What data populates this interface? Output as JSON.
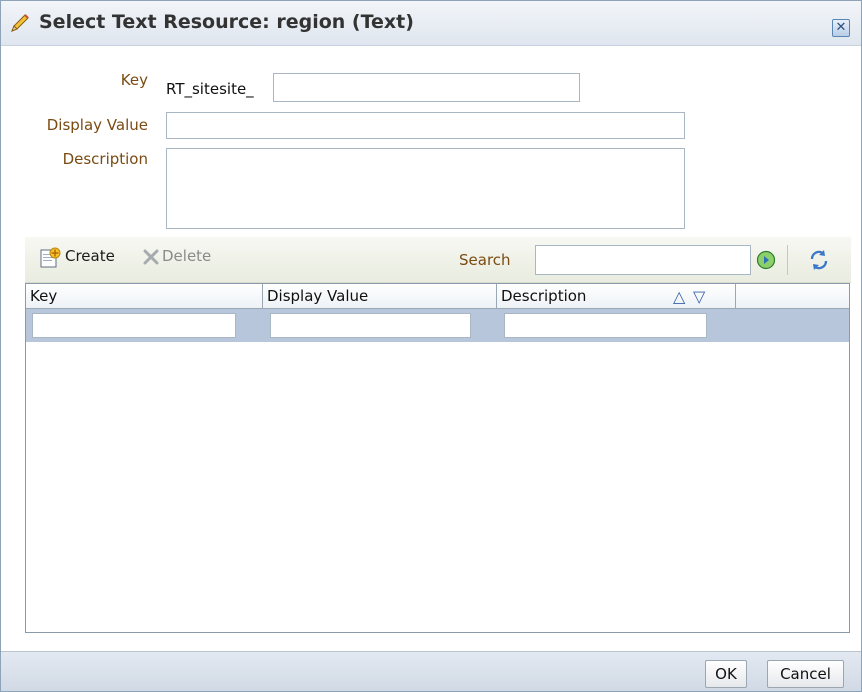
{
  "dialog": {
    "title": "Select Text Resource: region (Text)",
    "close_symbol": "✕"
  },
  "form": {
    "key_label": "Key",
    "key_prefix": "RT_sitesite_",
    "key_value": "",
    "display_label": "Display Value",
    "display_value": "",
    "description_label": "Description",
    "description_value": ""
  },
  "toolbar": {
    "create_label": "Create",
    "delete_label": "Delete",
    "search_label": "Search",
    "search_value": ""
  },
  "table": {
    "columns": [
      "Key",
      "Display Value",
      "Description"
    ],
    "sort_ascending_symbol": "△",
    "sort_descending_symbol": "▽",
    "filters": [
      "",
      "",
      ""
    ],
    "rows": []
  },
  "footer": {
    "ok_label": "OK",
    "cancel_label": "Cancel"
  },
  "colors": {
    "label_text": "#7a4b12",
    "header_bg": "#dfe6ef",
    "filter_row_bg": "#b7c6da",
    "footer_bg": "#cfd8e4"
  },
  "icons": {
    "title": "pencil-icon",
    "create": "new-document-icon",
    "delete": "delete-x-icon",
    "search_go": "go-arrow-icon",
    "refresh": "refresh-icon",
    "close": "close-icon"
  }
}
